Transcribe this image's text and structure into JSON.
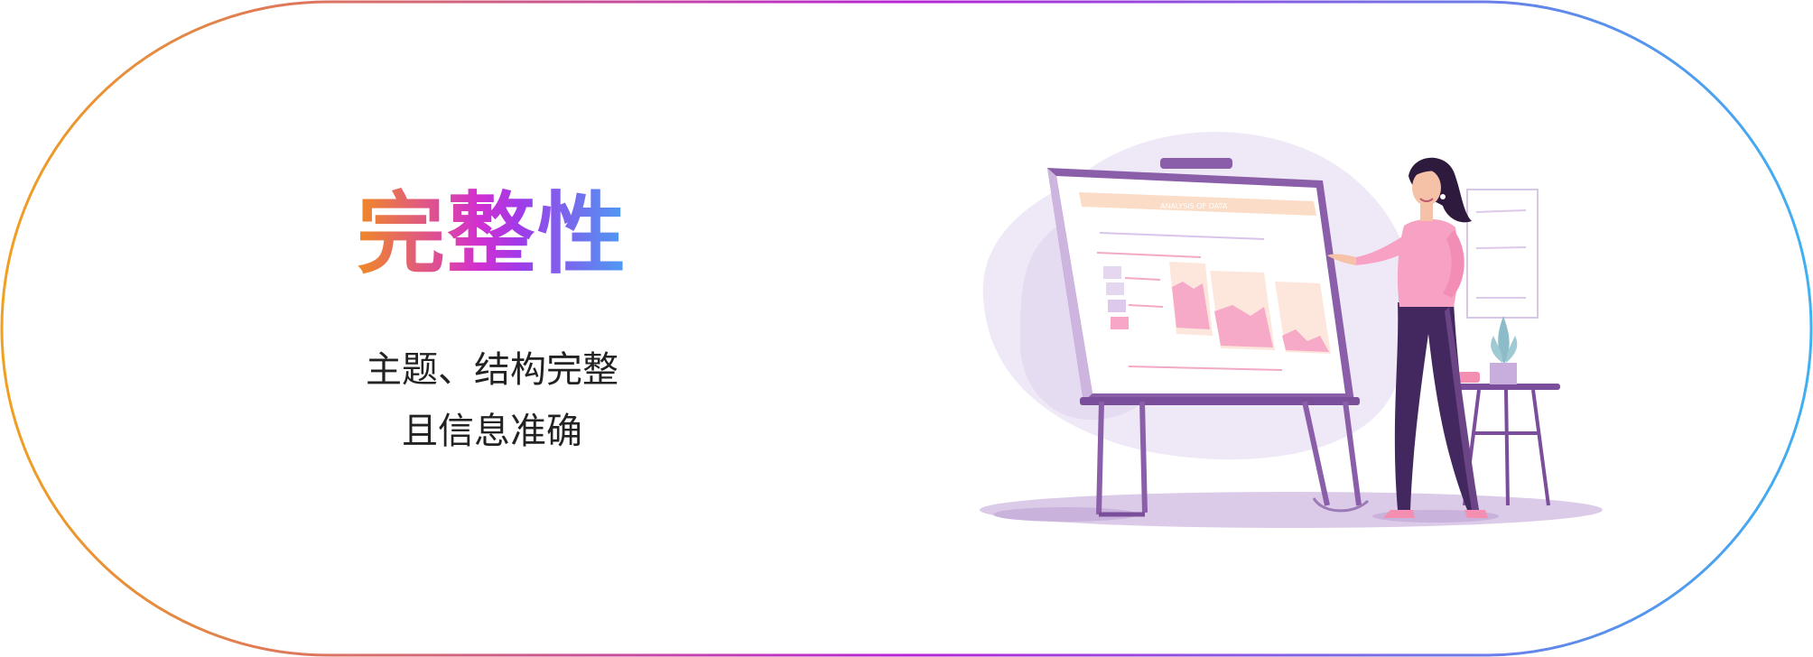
{
  "card": {
    "title": "完整性",
    "description_line1": "主题、结构完整",
    "description_line2": "且信息准确"
  },
  "colors": {
    "gradient_start": "#f0a020",
    "gradient_mid": "#b623d6",
    "gradient_end": "#3fb0f2",
    "text": "#222222"
  },
  "illustration": {
    "icon": "woman-presenting-chart-on-easel",
    "board_heading": "ANALYSIS OF DATA"
  }
}
